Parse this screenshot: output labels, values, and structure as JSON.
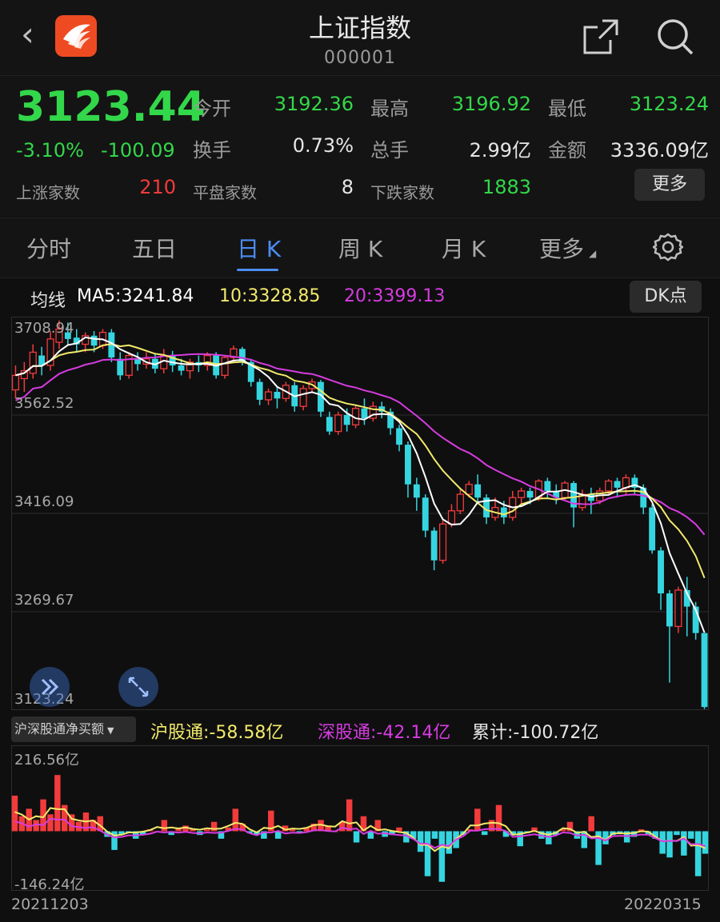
{
  "header": {
    "back_icon": "chevron-left-icon",
    "title": "上证指数",
    "code": "000001",
    "share_icon": "share-icon",
    "search_icon": "search-icon"
  },
  "quote": {
    "price": "3123.44",
    "change_pct": "-3.10%",
    "change": "-100.09",
    "open_label": "今开",
    "open": "3192.36",
    "high_label": "最高",
    "high": "3196.92",
    "low_label": "最低",
    "low": "3123.24",
    "turnover_label": "换手",
    "turnover": "0.73%",
    "volume_label": "总手",
    "volume": "2.99亿",
    "amount_label": "金额",
    "amount": "3336.09亿",
    "up_label": "上涨家数",
    "up": "210",
    "flat_label": "平盘家数",
    "flat": "8",
    "down_label": "下跌家数",
    "down": "1883",
    "more": "更多"
  },
  "tabs": [
    {
      "label": "分时"
    },
    {
      "label": "五日"
    },
    {
      "label": "日 K",
      "active": true
    },
    {
      "label": "周 K"
    },
    {
      "label": "月 K"
    },
    {
      "label": "更多"
    }
  ],
  "ma": {
    "label": "均线",
    "ma5": "MA5:3241.84",
    "ma10": "10:3328.85",
    "ma20": "20:3399.13",
    "dk_button": "DK点"
  },
  "colors": {
    "up": "#f23b3b",
    "down": "#35d5e0",
    "ma5": "#ffffff",
    "ma10": "#f2ea6a",
    "ma20": "#d63ce0",
    "accent": "#4b8cf0",
    "green": "#33d74a"
  },
  "chart_data": [
    {
      "type": "candlestick",
      "y_ticks": [
        "3708.94",
        "3562.52",
        "3416.09",
        "3269.67",
        "3123.24"
      ],
      "ylim": [
        3123.24,
        3708.94
      ],
      "x_start": "20211203",
      "x_end": "20220315",
      "candles": [
        [
          3603,
          3625,
          3590,
          3640
        ],
        [
          3620,
          3632,
          3600,
          3645
        ],
        [
          3628,
          3660,
          3620,
          3672
        ],
        [
          3655,
          3640,
          3625,
          3668
        ],
        [
          3640,
          3680,
          3632,
          3692
        ],
        [
          3675,
          3695,
          3665,
          3708
        ],
        [
          3690,
          3680,
          3670,
          3705
        ],
        [
          3682,
          3672,
          3660,
          3695
        ],
        [
          3672,
          3685,
          3660,
          3690
        ],
        [
          3685,
          3670,
          3660,
          3692
        ],
        [
          3670,
          3690,
          3665,
          3695
        ],
        [
          3690,
          3652,
          3645,
          3695
        ],
        [
          3650,
          3625,
          3618,
          3660
        ],
        [
          3625,
          3655,
          3620,
          3660
        ],
        [
          3650,
          3642,
          3632,
          3660
        ],
        [
          3642,
          3650,
          3635,
          3660
        ],
        [
          3650,
          3635,
          3628,
          3658
        ],
        [
          3635,
          3655,
          3628,
          3665
        ],
        [
          3655,
          3640,
          3630,
          3662
        ],
        [
          3640,
          3632,
          3625,
          3650
        ],
        [
          3632,
          3645,
          3620,
          3650
        ],
        [
          3645,
          3640,
          3630,
          3655
        ],
        [
          3640,
          3655,
          3632,
          3660
        ],
        [
          3655,
          3625,
          3620,
          3660
        ],
        [
          3625,
          3652,
          3620,
          3655
        ],
        [
          3652,
          3665,
          3645,
          3670
        ],
        [
          3665,
          3645,
          3640,
          3668
        ],
        [
          3645,
          3615,
          3608,
          3650
        ],
        [
          3615,
          3588,
          3580,
          3620
        ],
        [
          3588,
          3600,
          3580,
          3605
        ],
        [
          3600,
          3590,
          3575,
          3608
        ],
        [
          3590,
          3610,
          3585,
          3615
        ],
        [
          3610,
          3578,
          3570,
          3615
        ],
        [
          3578,
          3605,
          3572,
          3610
        ],
        [
          3605,
          3615,
          3598,
          3620
        ],
        [
          3615,
          3570,
          3562,
          3618
        ],
        [
          3562,
          3540,
          3535,
          3570
        ],
        [
          3540,
          3565,
          3535,
          3570
        ],
        [
          3565,
          3550,
          3540,
          3575
        ],
        [
          3550,
          3575,
          3545,
          3580
        ],
        [
          3575,
          3560,
          3550,
          3590
        ],
        [
          3560,
          3578,
          3555,
          3585
        ],
        [
          3578,
          3570,
          3560,
          3585
        ],
        [
          3570,
          3545,
          3535,
          3575
        ],
        [
          3545,
          3520,
          3510,
          3550
        ],
        [
          3520,
          3460,
          3440,
          3525
        ],
        [
          3460,
          3440,
          3420,
          3470
        ],
        [
          3440,
          3390,
          3380,
          3445
        ],
        [
          3390,
          3345,
          3330,
          3395
        ],
        [
          3345,
          3400,
          3340,
          3405
        ],
        [
          3400,
          3420,
          3395,
          3430
        ],
        [
          3420,
          3445,
          3415,
          3455
        ],
        [
          3445,
          3460,
          3440,
          3465
        ],
        [
          3460,
          3440,
          3430,
          3475
        ],
        [
          3440,
          3410,
          3400,
          3445
        ],
        [
          3410,
          3425,
          3405,
          3440
        ],
        [
          3425,
          3410,
          3400,
          3435
        ],
        [
          3410,
          3440,
          3405,
          3450
        ],
        [
          3440,
          3450,
          3430,
          3455
        ],
        [
          3450,
          3440,
          3430,
          3455
        ],
        [
          3440,
          3465,
          3435,
          3468
        ],
        [
          3465,
          3450,
          3440,
          3470
        ],
        [
          3450,
          3440,
          3430,
          3460
        ],
        [
          3440,
          3462,
          3435,
          3465
        ],
        [
          3462,
          3425,
          3395,
          3465
        ],
        [
          3425,
          3445,
          3420,
          3452
        ],
        [
          3445,
          3435,
          3415,
          3455
        ],
        [
          3435,
          3450,
          3430,
          3455
        ],
        [
          3450,
          3465,
          3445,
          3468
        ],
        [
          3465,
          3455,
          3440,
          3470
        ],
        [
          3455,
          3470,
          3445,
          3475
        ],
        [
          3470,
          3455,
          3445,
          3475
        ],
        [
          3455,
          3425,
          3415,
          3460
        ],
        [
          3425,
          3360,
          3355,
          3430
        ],
        [
          3360,
          3295,
          3270,
          3365
        ],
        [
          3295,
          3245,
          3160,
          3300
        ],
        [
          3245,
          3300,
          3235,
          3305
        ],
        [
          3300,
          3275,
          3230,
          3320
        ],
        [
          3275,
          3235,
          3225,
          3282
        ],
        [
          3235,
          3123,
          3120,
          3235
        ]
      ]
    },
    {
      "type": "bar",
      "title": "沪深股通净买额",
      "series_labels": [
        "沪股通:-58.58亿",
        "深股通:-42.14亿",
        "累计:-100.72亿"
      ],
      "y_ticks": [
        "216.56亿",
        "-146.24亿"
      ],
      "ylim": [
        -146.24,
        216.56
      ],
      "values": [
        95,
        40,
        60,
        30,
        85,
        45,
        150,
        70,
        45,
        25,
        50,
        30,
        40,
        -15,
        -50,
        -10,
        -5,
        -20,
        -10,
        5,
        0,
        30,
        -10,
        10,
        15,
        5,
        -10,
        5,
        25,
        -20,
        10,
        60,
        20,
        -5,
        -10,
        -20,
        55,
        -20,
        15,
        5,
        -5,
        10,
        20,
        30,
        15,
        0,
        25,
        85,
        -30,
        40,
        -20,
        30,
        -15,
        -10,
        10,
        -30,
        -20,
        -55,
        -120,
        -20,
        -135,
        -60,
        -45,
        -10,
        5,
        60,
        -10,
        30,
        70,
        -15,
        -10,
        -40,
        -5,
        10,
        -20,
        -35,
        -10,
        5,
        25,
        -20,
        -45,
        40,
        -90,
        -35,
        -10,
        -5,
        -30,
        -15,
        5,
        -10,
        -20,
        -60,
        -70,
        -10,
        -65,
        -20,
        -120,
        -60
      ]
    }
  ]
}
